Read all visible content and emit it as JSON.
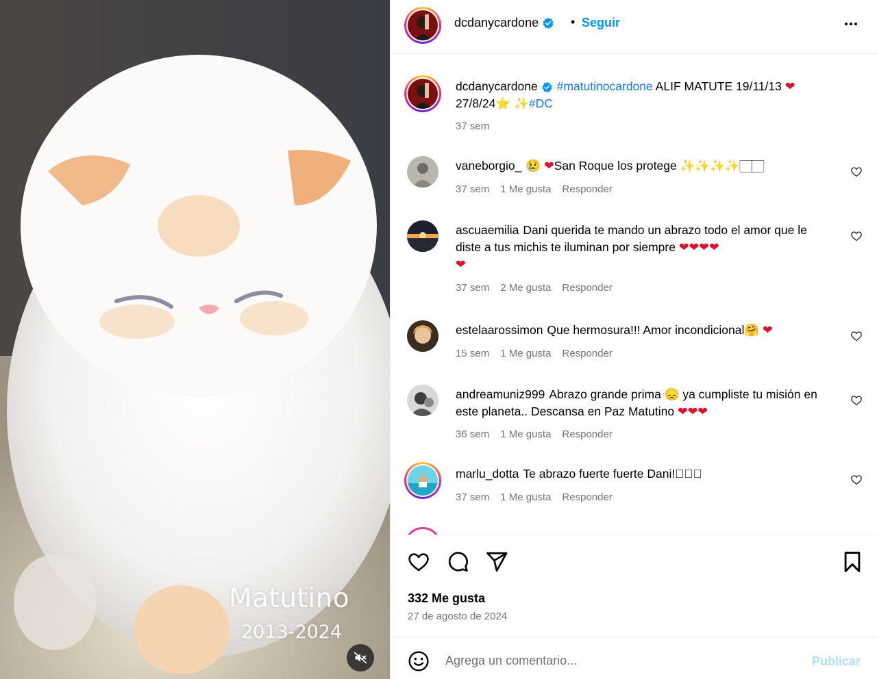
{
  "media": {
    "overlay_title": "Matutino",
    "overlay_years": "2013-2024",
    "mute_icon": "speaker-muted-icon"
  },
  "header": {
    "username": "dcdanycardone",
    "verified": true,
    "separator": "•",
    "follow_label": "Seguir",
    "more_icon": "more-horizontal-icon"
  },
  "caption": {
    "username": "dcdanycardone",
    "hashtag": "#matutinocardone",
    "text_1": " ALIF MATUTE 19/11/13 ",
    "text_2": "27/8/24",
    "text_3": "#DC",
    "time": "37 sem"
  },
  "comments": [
    {
      "username": "vaneborgio_",
      "text": "San Roque los protege ✨✨✨✨🏻🏻",
      "time": "37 sem",
      "likes": "1 Me gusta",
      "reply": "Responder"
    },
    {
      "username": "ascuaemilia",
      "text": "Dani querida te mando un abrazo todo el amor que le diste a tus michis te iluminan por siempre",
      "time": "37 sem",
      "likes": "2 Me gusta",
      "reply": "Responder"
    },
    {
      "username": "estelaarossimon",
      "text": "Que hermosura!!! Amor incondicional",
      "time": "15 sem",
      "likes": "1 Me gusta",
      "reply": "Responder"
    },
    {
      "username": "andreamuniz999",
      "text_1": "Abrazo grande prima ",
      "text_2": " ya cumpliste tu misión en este planeta.. Descansa en Paz Matutino ",
      "time": "36 sem",
      "likes": "1 Me gusta",
      "reply": "Responder"
    },
    {
      "username": "marlu_dotta",
      "text": "Te abrazo fuerte fuerte Dani!🏻🏻🏻",
      "time": "37 sem",
      "likes": "1 Me gusta",
      "reply": "Responder"
    }
  ],
  "actions": {
    "like_icon": "heart-icon",
    "comment_icon": "comment-bubble-icon",
    "share_icon": "paper-plane-icon",
    "save_icon": "bookmark-icon",
    "likes_count": "332 Me gusta",
    "date": "27 de agosto de 2024"
  },
  "comment_box": {
    "emoji_icon": "smiley-icon",
    "placeholder": "Agrega un comentario...",
    "publish_label": "Publicar"
  },
  "colors": {
    "accent": "#0095f6",
    "hashtag": "#1877f2",
    "muted_text": "#737373",
    "publish_disabled": "#b2dffc",
    "heart": "#e0102a"
  }
}
